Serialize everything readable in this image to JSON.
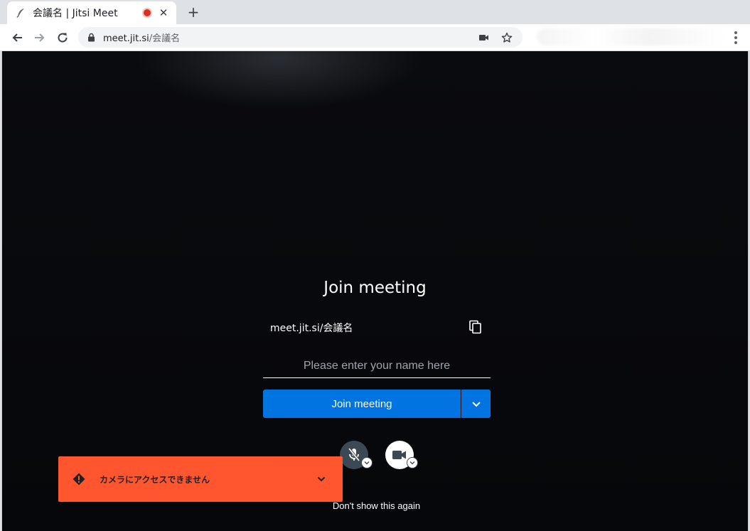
{
  "browser": {
    "tab": {
      "title": "会議名 | Jitsi Meet",
      "favicon": "jitsi-feather-icon",
      "recording_indicator": "red-record-dot"
    },
    "omnibox": {
      "host": "meet.jit.si",
      "path": "/会議名"
    },
    "icons": [
      "back-arrow-icon",
      "forward-arrow-icon",
      "reload-icon",
      "lock-icon",
      "camera-icon",
      "star-icon",
      "kebab-menu-icon"
    ]
  },
  "prejoin": {
    "title": "Join meeting",
    "room_url": "meet.jit.si/会議名",
    "name_placeholder": "Please enter your name here",
    "join_label": "Join meeting",
    "dont_show": "Don't show this again"
  },
  "toast": {
    "message": "カメラにアクセスできません"
  },
  "colors": {
    "primary": "#0074e0",
    "error": "#ff5630",
    "background": "#0a0b0e",
    "mic_button": "#3d4855"
  }
}
